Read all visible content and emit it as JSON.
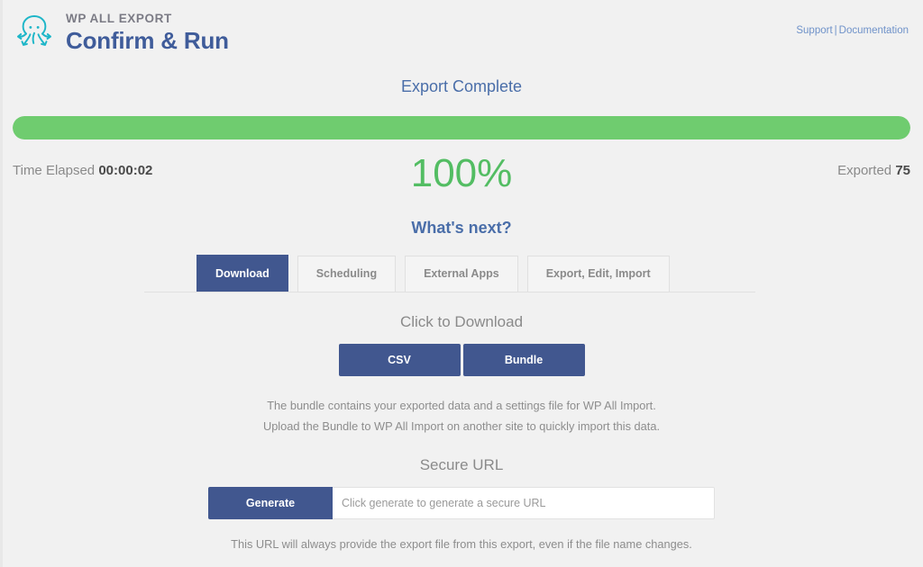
{
  "header": {
    "eyebrow": "WP ALL EXPORT",
    "title": "Confirm & Run",
    "logo_icon": "octopus-icon",
    "links": {
      "support": "Support",
      "separator": "|",
      "documentation": "Documentation"
    }
  },
  "status": {
    "heading": "Export Complete",
    "progress_percent": 100,
    "progress_fill_color": "#6fcc6f",
    "percent_label": "100%",
    "time_elapsed_label": "Time Elapsed",
    "time_elapsed_value": "00:00:02",
    "exported_label": "Exported",
    "exported_value": "75"
  },
  "next": {
    "heading": "What's next?",
    "tabs": [
      {
        "label": "Download",
        "active": true
      },
      {
        "label": "Scheduling",
        "active": false
      },
      {
        "label": "External Apps",
        "active": false
      },
      {
        "label": "Export, Edit, Import",
        "active": false
      }
    ]
  },
  "download_panel": {
    "click_to_download_label": "Click to Download",
    "csv_button": "CSV",
    "bundle_button": "Bundle",
    "note_line_1": "The bundle contains your exported data and a settings file for WP All Import.",
    "note_line_2": "Upload the Bundle to WP All Import on another site to quickly import this data.",
    "secure_url_label": "Secure URL",
    "generate_button": "Generate",
    "secure_url_placeholder": "Click generate to generate a secure URL",
    "secure_url_value": "",
    "footnote": "This URL will always provide the export file from this export, even if the file name changes."
  },
  "theme": {
    "accent_blue": "#41578f",
    "heading_blue": "#4a6ea9",
    "success_green": "#53bd63",
    "progress_green": "#6fcc6f",
    "page_background": "#f1f1f1",
    "logo_teal": "#1eb6c8"
  }
}
